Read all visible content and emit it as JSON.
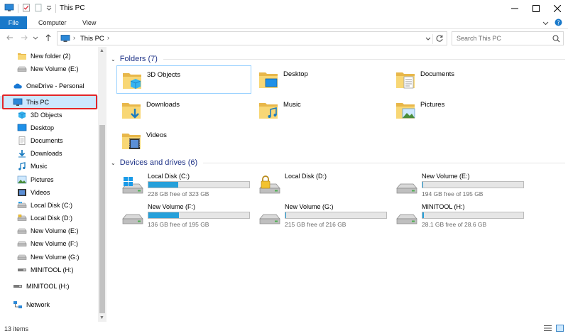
{
  "window": {
    "title": "This PC"
  },
  "ribbon": {
    "tabs": [
      "File",
      "Computer",
      "View"
    ]
  },
  "address": {
    "crumb": "This PC"
  },
  "search": {
    "placeholder": "Search This PC"
  },
  "nav": {
    "items": [
      {
        "label": "New folder (2)",
        "icon": "folder-icon",
        "indent": 2
      },
      {
        "label": "New Volume (E:)",
        "icon": "drive-icon",
        "indent": 2
      },
      {
        "label": "OneDrive - Personal",
        "icon": "onedrive-icon",
        "indent": 1
      },
      {
        "label": "This PC",
        "icon": "computer-icon",
        "indent": 1
      },
      {
        "label": "3D Objects",
        "icon": "3d-objects-icon",
        "indent": 2
      },
      {
        "label": "Desktop",
        "icon": "desktop-icon",
        "indent": 2
      },
      {
        "label": "Documents",
        "icon": "documents-icon",
        "indent": 2
      },
      {
        "label": "Downloads",
        "icon": "downloads-icon",
        "indent": 2
      },
      {
        "label": "Music",
        "icon": "music-icon",
        "indent": 2
      },
      {
        "label": "Pictures",
        "icon": "pictures-icon",
        "indent": 2
      },
      {
        "label": "Videos",
        "icon": "videos-icon",
        "indent": 2
      },
      {
        "label": "Local Disk (C:)",
        "icon": "windows-drive-icon",
        "indent": 2
      },
      {
        "label": "Local Disk (D:)",
        "icon": "locked-drive-icon",
        "indent": 2
      },
      {
        "label": "New Volume (E:)",
        "icon": "drive-icon",
        "indent": 2
      },
      {
        "label": "New Volume (F:)",
        "icon": "drive-icon",
        "indent": 2
      },
      {
        "label": "New Volume (G:)",
        "icon": "drive-icon",
        "indent": 2
      },
      {
        "label": "MINITOOL (H:)",
        "icon": "usb-drive-icon",
        "indent": 2
      },
      {
        "label": "MINITOOL (H:)",
        "icon": "usb-drive-icon",
        "indent": 1
      },
      {
        "label": "Network",
        "icon": "network-icon",
        "indent": 1
      }
    ]
  },
  "folders": {
    "header": "Folders (7)",
    "items": [
      {
        "label": "3D Objects",
        "icon": "3d-objects-icon"
      },
      {
        "label": "Desktop",
        "icon": "desktop-icon"
      },
      {
        "label": "Documents",
        "icon": "documents-icon"
      },
      {
        "label": "Downloads",
        "icon": "downloads-icon"
      },
      {
        "label": "Music",
        "icon": "music-icon"
      },
      {
        "label": "Pictures",
        "icon": "pictures-icon"
      },
      {
        "label": "Videos",
        "icon": "videos-icon"
      }
    ]
  },
  "drives": {
    "header": "Devices and drives (6)",
    "items": [
      {
        "label": "Local Disk (C:)",
        "free_text": "228 GB free of 323 GB",
        "used_fraction": 0.294,
        "icon": "windows-drive-icon"
      },
      {
        "label": "Local Disk (D:)",
        "free_text": "",
        "used_fraction": null,
        "icon": "locked-drive-icon"
      },
      {
        "label": "New Volume (E:)",
        "free_text": "194 GB free of 195 GB",
        "used_fraction": 0.005,
        "icon": "drive-icon"
      },
      {
        "label": "New Volume (F:)",
        "free_text": "136 GB free of 195 GB",
        "used_fraction": 0.303,
        "icon": "drive-icon"
      },
      {
        "label": "New Volume (G:)",
        "free_text": "215 GB free of 216 GB",
        "used_fraction": 0.005,
        "icon": "drive-icon"
      },
      {
        "label": "MINITOOL (H:)",
        "free_text": "28.1 GB free of 28.6 GB",
        "used_fraction": 0.017,
        "icon": "usb-drive-icon"
      }
    ]
  },
  "status": {
    "count": "13 items"
  },
  "colors": {
    "accent": "#1979ca",
    "section_title": "#1e3287",
    "bar_fill": "#26a0da",
    "selection": "#cce8ff",
    "highlight": "#e3262a"
  }
}
